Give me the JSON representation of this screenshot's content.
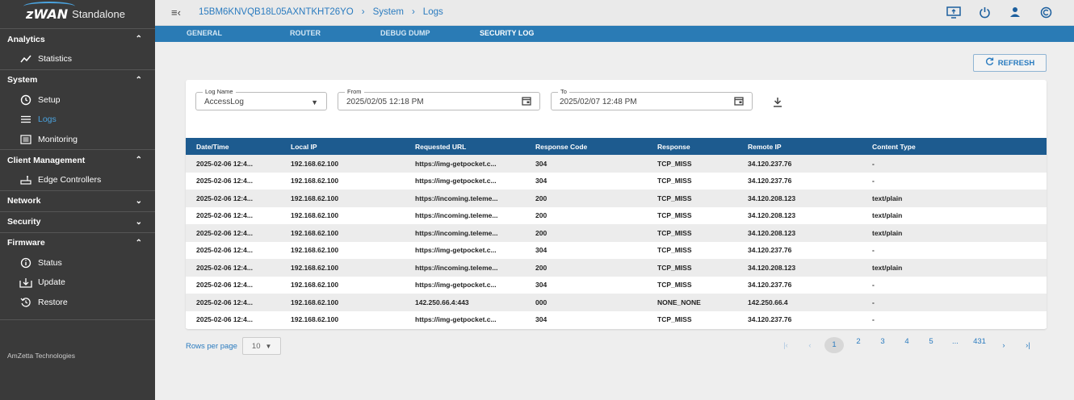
{
  "brand": {
    "logo": "zWAN",
    "product": "Standalone"
  },
  "sidebar": {
    "sections": [
      {
        "title": "Analytics",
        "items": [
          {
            "label": "Statistics",
            "icon": "line-chart-icon"
          }
        ]
      },
      {
        "title": "System",
        "items": [
          {
            "label": "Setup",
            "icon": "clock-icon"
          },
          {
            "label": "Logs",
            "icon": "list-icon",
            "active": true
          },
          {
            "label": "Monitoring",
            "icon": "monitor-list-icon"
          }
        ]
      },
      {
        "title": "Client Management",
        "items": [
          {
            "label": "Edge Controllers",
            "icon": "router-icon"
          }
        ]
      },
      {
        "title": "Network",
        "items": []
      },
      {
        "title": "Security",
        "items": []
      },
      {
        "title": "Firmware",
        "items": [
          {
            "label": "Status",
            "icon": "info-icon"
          },
          {
            "label": "Update",
            "icon": "download-box-icon"
          },
          {
            "label": "Restore",
            "icon": "restore-icon"
          }
        ]
      }
    ],
    "footer": "AmZetta Technologies"
  },
  "breadcrumb": {
    "device": "15BM6KNVQB18L05AXNTKHT26YO",
    "section": "System",
    "page": "Logs"
  },
  "tabs": [
    {
      "label": "GENERAL"
    },
    {
      "label": "ROUTER"
    },
    {
      "label": "DEBUG DUMP"
    },
    {
      "label": "SECURITY LOG",
      "active": true
    }
  ],
  "refresh_label": "REFRESH",
  "filters": {
    "log_name": {
      "label": "Log Name",
      "value": "AccessLog"
    },
    "from": {
      "label": "From",
      "value": "2025/02/05 12:18 PM"
    },
    "to": {
      "label": "To",
      "value": "2025/02/07 12:48 PM"
    }
  },
  "table": {
    "columns": [
      "Date/Time",
      "Local IP",
      "Requested URL",
      "Response Code",
      "Response",
      "Remote IP",
      "Content Type"
    ],
    "rows": [
      [
        "2025-02-06 12:4...",
        "192.168.62.100",
        "https://img-getpocket.c...",
        "304",
        "TCP_MISS",
        "34.120.237.76",
        "-"
      ],
      [
        "2025-02-06 12:4...",
        "192.168.62.100",
        "https://img-getpocket.c...",
        "304",
        "TCP_MISS",
        "34.120.237.76",
        "-"
      ],
      [
        "2025-02-06 12:4...",
        "192.168.62.100",
        "https://incoming.teleme...",
        "200",
        "TCP_MISS",
        "34.120.208.123",
        "text/plain"
      ],
      [
        "2025-02-06 12:4...",
        "192.168.62.100",
        "https://incoming.teleme...",
        "200",
        "TCP_MISS",
        "34.120.208.123",
        "text/plain"
      ],
      [
        "2025-02-06 12:4...",
        "192.168.62.100",
        "https://incoming.teleme...",
        "200",
        "TCP_MISS",
        "34.120.208.123",
        "text/plain"
      ],
      [
        "2025-02-06 12:4...",
        "192.168.62.100",
        "https://img-getpocket.c...",
        "304",
        "TCP_MISS",
        "34.120.237.76",
        "-"
      ],
      [
        "2025-02-06 12:4...",
        "192.168.62.100",
        "https://incoming.teleme...",
        "200",
        "TCP_MISS",
        "34.120.208.123",
        "text/plain"
      ],
      [
        "2025-02-06 12:4...",
        "192.168.62.100",
        "https://img-getpocket.c...",
        "304",
        "TCP_MISS",
        "34.120.237.76",
        "-"
      ],
      [
        "2025-02-06 12:4...",
        "192.168.62.100",
        "142.250.66.4:443",
        "000",
        "NONE_NONE",
        "142.250.66.4",
        "-"
      ],
      [
        "2025-02-06 12:4...",
        "192.168.62.100",
        "https://img-getpocket.c...",
        "304",
        "TCP_MISS",
        "34.120.237.76",
        "-"
      ]
    ]
  },
  "pagination": {
    "rows_per_page_label": "Rows per page",
    "rows_per_page": "10",
    "pages": [
      "1",
      "2",
      "3",
      "4",
      "5",
      "...",
      "431"
    ],
    "current": "1"
  },
  "colors": {
    "accent": "#2a7bbf",
    "tab_bar": "#2a7bb5",
    "table_header": "#1d5b8f",
    "sidebar": "#3a3a3a"
  }
}
